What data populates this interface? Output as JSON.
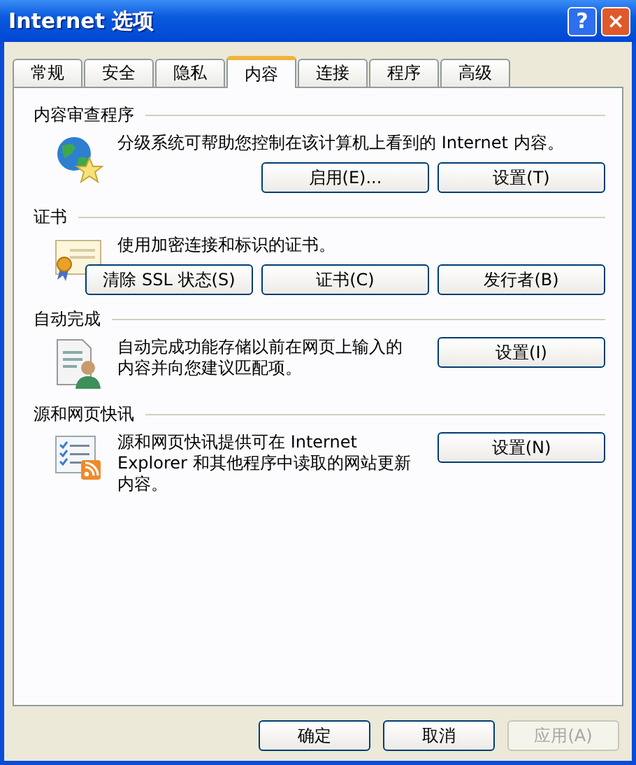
{
  "window": {
    "title": "Internet 选项",
    "help_button": "?",
    "close_button": "×"
  },
  "tabs": [
    {
      "label": "常规",
      "selected": false
    },
    {
      "label": "安全",
      "selected": false
    },
    {
      "label": "隐私",
      "selected": false
    },
    {
      "label": "内容",
      "selected": true
    },
    {
      "label": "连接",
      "selected": false
    },
    {
      "label": "程序",
      "selected": false
    },
    {
      "label": "高级",
      "selected": false
    }
  ],
  "sections": [
    {
      "title": "内容审查程序",
      "description": "分级系统可帮助您控制在该计算机上看到的 Internet 内容。",
      "buttons": [
        {
          "label": "启用(E)...",
          "disabled": false
        },
        {
          "label": "设置(T)",
          "disabled": false
        }
      ]
    },
    {
      "title": "证书",
      "description": "使用加密连接和标识的证书。",
      "buttons": [
        {
          "label": "清除 SSL 状态(S)",
          "disabled": false
        },
        {
          "label": "证书(C)",
          "disabled": false
        },
        {
          "label": "发行者(B)",
          "disabled": false
        }
      ]
    },
    {
      "title": "自动完成",
      "description": "自动完成功能存储以前在网页上输入的内容并向您建议匹配项。",
      "buttons": [
        {
          "label": "设置(I)",
          "disabled": false
        }
      ]
    },
    {
      "title": "源和网页快讯",
      "description": "源和网页快讯提供可在 Internet Explorer 和其他程序中读取的网站更新内容。",
      "buttons": [
        {
          "label": "设置(N)",
          "disabled": false
        }
      ]
    }
  ],
  "footer_buttons": [
    {
      "label": "确定",
      "disabled": false
    },
    {
      "label": "取消",
      "disabled": false
    },
    {
      "label": "应用(A)",
      "disabled": true
    }
  ]
}
